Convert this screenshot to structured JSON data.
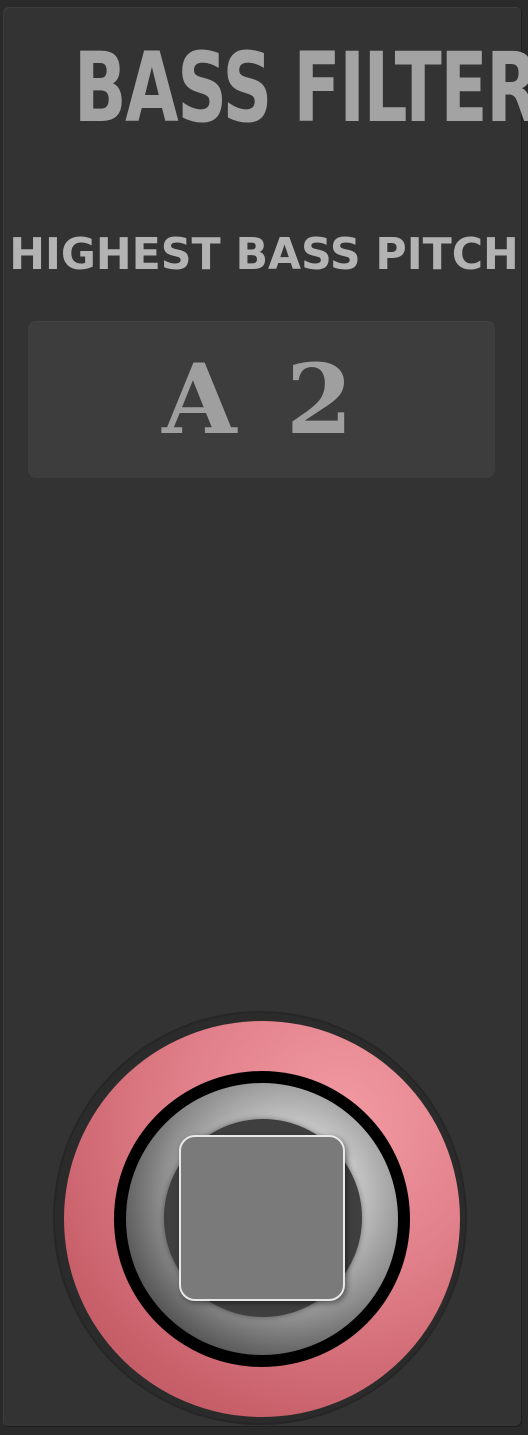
{
  "plugin": {
    "title": "BASS FILTER",
    "parameter": {
      "label": "HIGHEST BASS PITCH",
      "value": "A 2"
    },
    "footswitch": {
      "ring_color": "#e07f89"
    }
  },
  "colors": {
    "panel_bg": "#333333",
    "display_bg": "#3d3d3d",
    "text": "#a3a3a3"
  }
}
